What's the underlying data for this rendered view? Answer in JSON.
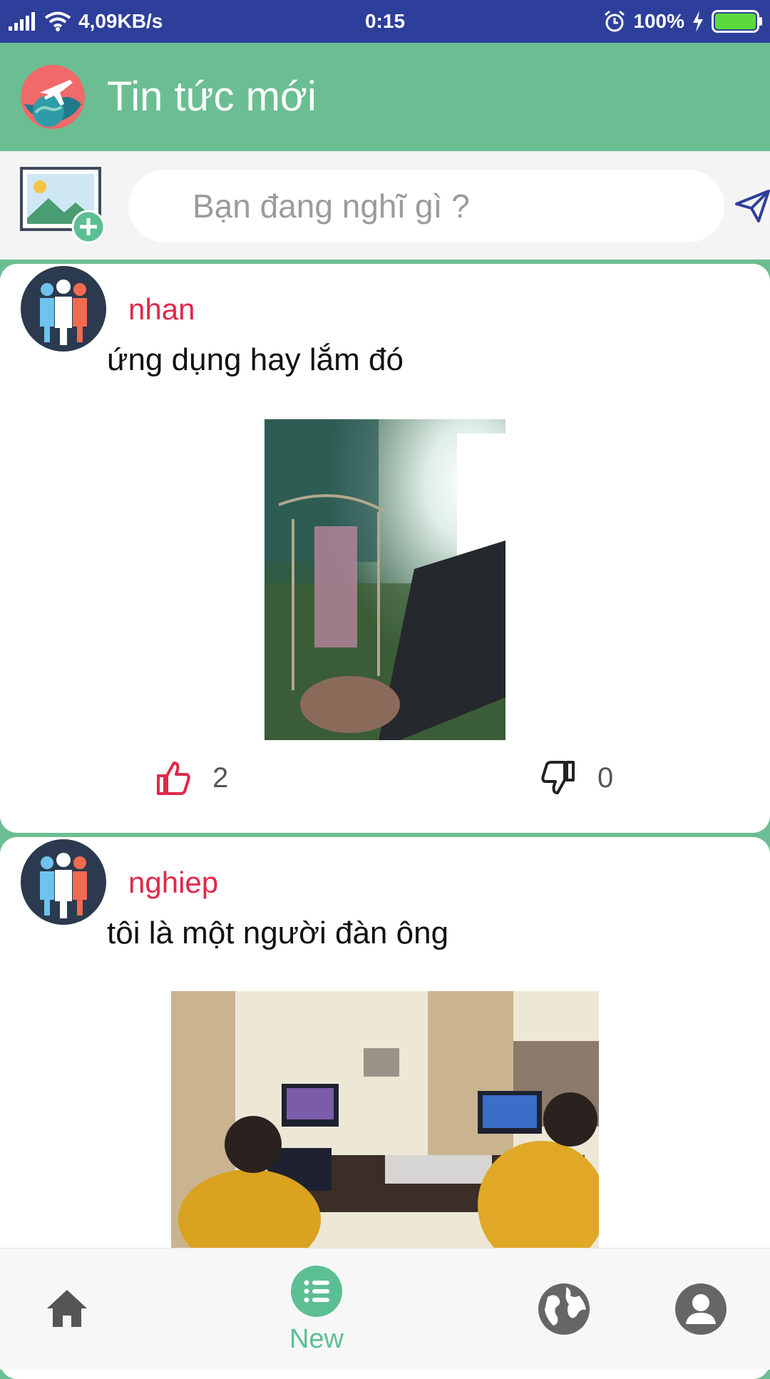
{
  "status": {
    "speed": "4,09KB/s",
    "time": "0:15",
    "battery": "100%"
  },
  "header": {
    "title": "Tin tức mới"
  },
  "composer": {
    "placeholder": "Bạn đang nghĩ gì ?"
  },
  "posts": [
    {
      "author": "nhan",
      "text": "ứng dụng hay lắm đó",
      "likes": "2",
      "dislikes": "0"
    },
    {
      "author": "nghiep",
      "text": "tôi là một người đàn ông"
    }
  ],
  "nav": {
    "new_label": "New"
  },
  "colors": {
    "primary": "#6BBE92",
    "statusbar": "#2E3F9B",
    "author": "#E0284A",
    "like": "#E0284A",
    "nav_active": "#5CBF93"
  },
  "icons": [
    "signal-icon",
    "wifi-icon",
    "alarm-icon",
    "charging-icon",
    "battery-icon",
    "app-logo-icon",
    "add-photo-icon",
    "send-icon",
    "avatar-group-icon",
    "thumbs-up-icon",
    "thumbs-down-icon",
    "home-icon",
    "list-icon",
    "globe-icon",
    "profile-icon"
  ]
}
